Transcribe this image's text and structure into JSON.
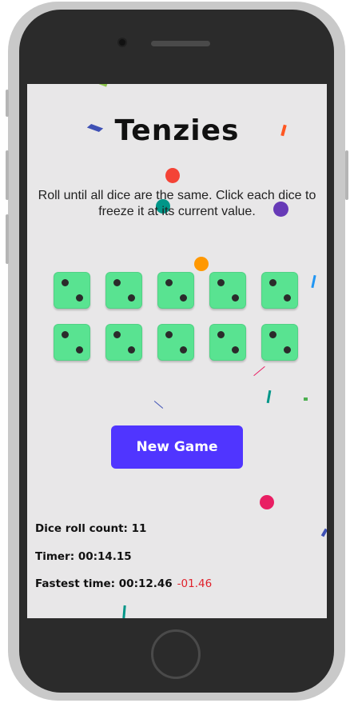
{
  "app": {
    "title": "Tenzies",
    "instructions": "Roll until all dice are the same. Click each dice to freeze it at its current value."
  },
  "dice": [
    {
      "value": 2,
      "held": false
    },
    {
      "value": 2,
      "held": false
    },
    {
      "value": 2,
      "held": false
    },
    {
      "value": 2,
      "held": false
    },
    {
      "value": 2,
      "held": false
    },
    {
      "value": 2,
      "held": false
    },
    {
      "value": 2,
      "held": false
    },
    {
      "value": 2,
      "held": false
    },
    {
      "value": 2,
      "held": false
    },
    {
      "value": 2,
      "held": false
    }
  ],
  "controls": {
    "new_game_label": "New Game"
  },
  "stats": {
    "roll_count_text": "Dice roll count: 11",
    "timer_text": "Timer: 00:14.15",
    "fastest_text": "Fastest time: 00:12.46",
    "fastest_delta": "-01.46"
  },
  "colors": {
    "die_face": "#59e391",
    "button": "#5035ff",
    "delta": "#e0212b",
    "screen_bg": "#e8e7e8"
  }
}
